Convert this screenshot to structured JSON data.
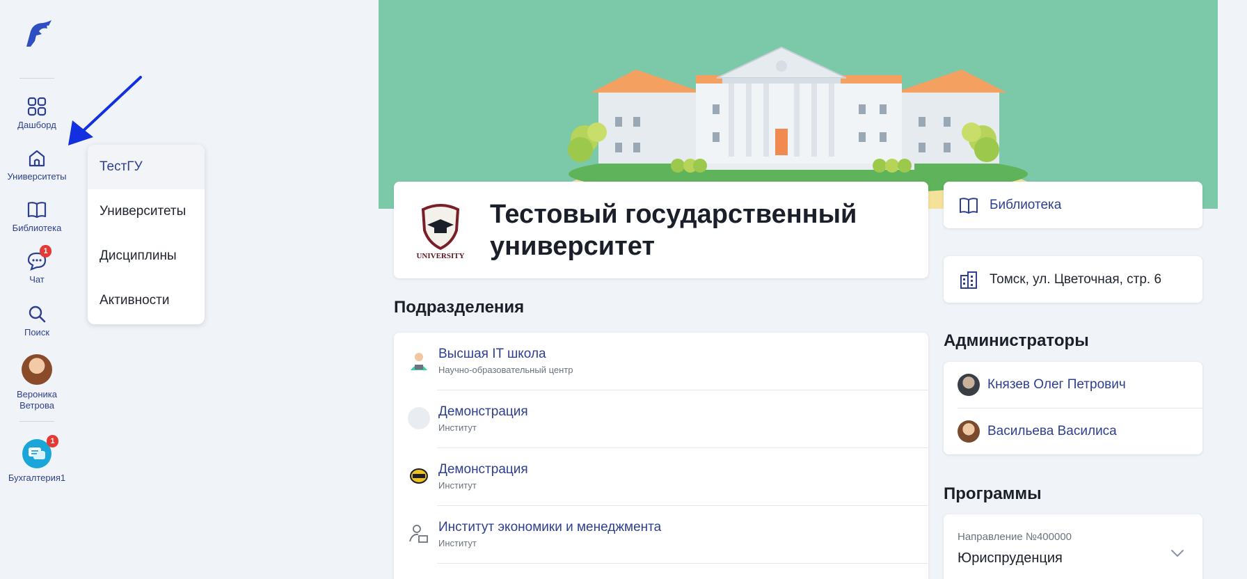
{
  "sidebar": {
    "items": [
      {
        "label": "Дашборд",
        "icon": "dashboard-icon"
      },
      {
        "label": "Университеты",
        "icon": "home-icon"
      },
      {
        "label": "Библиотека",
        "icon": "book-icon"
      },
      {
        "label": "Чат",
        "icon": "chat-icon",
        "badge": "1"
      },
      {
        "label": "Поиск",
        "icon": "search-icon"
      }
    ],
    "user": {
      "first": "Вероника",
      "last": "Ветрова"
    },
    "app": {
      "label": "Бухгалтерия1",
      "badge": "1"
    }
  },
  "dropdown": {
    "items": [
      "ТестГУ",
      "Университеты",
      "Дисциплины",
      "Активности"
    ],
    "active_index": 0
  },
  "university": {
    "title_line1": "Тестовый государственный",
    "title_line2": "университет",
    "logo_text": "UNIVERSITY"
  },
  "library": {
    "label": "Библиотека"
  },
  "address": {
    "text": "Томск, ул. Цветочная, стр. 6"
  },
  "divisions": {
    "heading": "Подразделения",
    "rows": [
      {
        "name": "Высшая IT школа",
        "type": "Научно-образовательный центр"
      },
      {
        "name": "Демонстрация",
        "type": "Институт"
      },
      {
        "name": "Демонстрация",
        "type": "Институт"
      },
      {
        "name": "Институт экономики и менеджмента",
        "type": "Институт"
      }
    ]
  },
  "admins": {
    "heading": "Администраторы",
    "rows": [
      {
        "name": "Князев Олег Петрович"
      },
      {
        "name": "Васильева Василиса"
      }
    ]
  },
  "programs": {
    "heading": "Программы",
    "first": {
      "direction": "Направление №400000",
      "name": "Юриспруденция"
    }
  },
  "colors": {
    "accent": "#2d3f8f",
    "hero": "#7cc9a9",
    "badge": "#e53935",
    "annotation_arrow": "#1330e0"
  }
}
